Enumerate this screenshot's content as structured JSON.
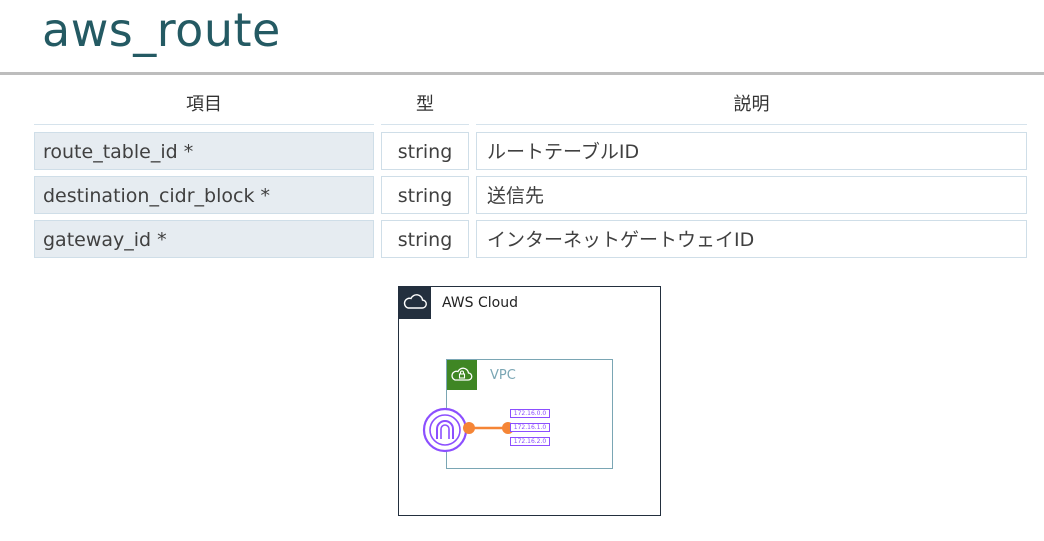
{
  "page": {
    "title": "aws_route"
  },
  "table": {
    "headers": {
      "item": "項目",
      "type": "型",
      "description": "説明"
    },
    "rows": [
      {
        "name": "route_table_id *",
        "type": "string",
        "description": "ルートテーブルID"
      },
      {
        "name": "destination_cidr_block *",
        "type": "string",
        "description": "送信先"
      },
      {
        "name": "gateway_id *",
        "type": "string",
        "description": "インターネットゲートウェイID"
      }
    ]
  },
  "diagram": {
    "cloud_label": "AWS Cloud",
    "vpc_label": "VPC",
    "route_entries": [
      "172.16.0.0",
      "172.16.1.0",
      "172.16.2.0"
    ],
    "colors": {
      "cloud_badge": "#232f3e",
      "vpc_badge": "#3f8624",
      "gateway": "#8c4fff",
      "link": "#f58536"
    },
    "icons": {
      "cloud": "cloud-icon",
      "vpc": "vpc-lock-cloud-icon",
      "gateway": "internet-gateway-icon"
    }
  }
}
